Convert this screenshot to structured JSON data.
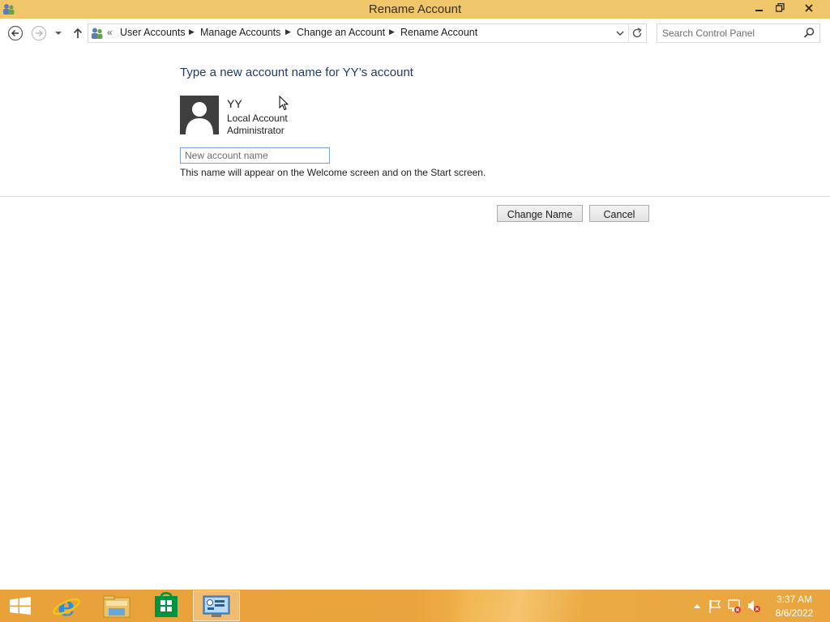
{
  "window": {
    "title": "Rename Account",
    "app_icon": "user-accounts-icon",
    "controls": [
      "minimize-icon",
      "restore-icon",
      "close-icon"
    ]
  },
  "navigation": {
    "back_icon": "back-arrow-icon",
    "forward_icon": "forward-arrow-icon",
    "recent_icon": "chevron-down-icon",
    "up_icon": "up-arrow-icon",
    "overflow": "«",
    "breadcrumbs": [
      "User Accounts",
      "Manage Accounts",
      "Change an Account",
      "Rename Account"
    ],
    "refresh_icon": "refresh-icon"
  },
  "search": {
    "placeholder": "Search Control Panel",
    "value": ""
  },
  "main": {
    "heading": "Type a new account name for YY’s account",
    "user": {
      "name": "YY",
      "account_type": "Local Account",
      "role": "Administrator",
      "avatar_icon": "user-avatar-icon"
    },
    "new_name": {
      "placeholder": "New account name",
      "value": ""
    },
    "hint": "This name will appear on the Welcome screen and on the Start screen.",
    "buttons": {
      "change": "Change Name",
      "cancel": "Cancel"
    }
  },
  "taskbar": {
    "apps": [
      "windows-start-icon",
      "internet-explorer-icon",
      "file-explorer-icon",
      "windows-store-icon",
      "control-panel-icon"
    ],
    "active_app": "control-panel-icon",
    "tray": [
      "show-hidden-icons-icon",
      "action-center-flag-icon",
      "network-icon",
      "volume-muted-icon"
    ],
    "time": "3:37 AM",
    "date": "8/6/2022"
  },
  "colors": {
    "title_bar": "#efc76a",
    "taskbar": "#e9a23a",
    "heading": "#1f3c6b"
  }
}
